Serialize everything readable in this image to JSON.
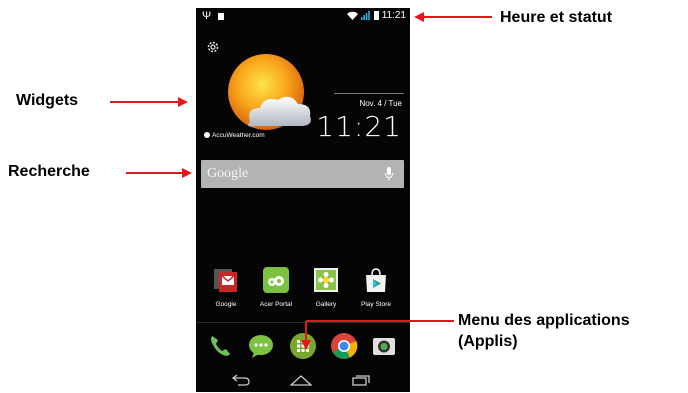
{
  "statusbar": {
    "time": "11:21"
  },
  "widget": {
    "weather_provider": "AccuWeather.com",
    "date": "Nov. 4 / Tue",
    "time": "11:21"
  },
  "search": {
    "placeholder": "Google"
  },
  "apps": [
    {
      "label": "Google",
      "icon": "google-folder-icon"
    },
    {
      "label": "Acer Portal",
      "icon": "acer-portal-icon"
    },
    {
      "label": "Gallery",
      "icon": "gallery-icon"
    },
    {
      "label": "Play Store",
      "icon": "play-store-icon"
    }
  ],
  "dock": [
    "phone-icon",
    "messaging-icon",
    "app-drawer-icon",
    "chrome-icon",
    "camera-icon"
  ],
  "navbar": [
    "back-icon",
    "home-icon",
    "recents-icon"
  ],
  "callouts": {
    "status": "Heure et statut",
    "widgets": "Widgets",
    "search": "Recherche",
    "apps_line1": "Menu des applications",
    "apps_line2": "(Applis)"
  },
  "colors": {
    "arrow": "#e8141c",
    "search_bar": "#b3b3b3"
  }
}
